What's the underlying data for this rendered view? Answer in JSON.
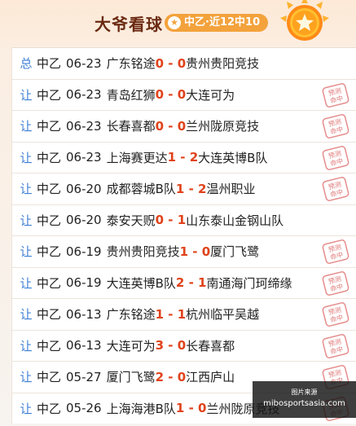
{
  "header": {
    "title": "大爷看球",
    "badge_icon": "star-icon",
    "badge_text": "中乙·近12中10",
    "medal_icon": "gold-star-medal-icon"
  },
  "stamp_text": "预测命中",
  "rows": [
    {
      "tag": "总",
      "league": "中乙",
      "date": "06-23",
      "home": "广东铭途",
      "score": "0 - 0",
      "away": "贵州贵阳竞技",
      "hit": false
    },
    {
      "tag": "让",
      "league": "中乙",
      "date": "06-23",
      "home": "青岛红狮",
      "score": "0 - 0",
      "away": "大连可为",
      "hit": true
    },
    {
      "tag": "让",
      "league": "中乙",
      "date": "06-23",
      "home": "长春喜都",
      "score": "0 - 0",
      "away": "兰州陇原竞技",
      "hit": true
    },
    {
      "tag": "让",
      "league": "中乙",
      "date": "06-23",
      "home": "上海赛更达",
      "score": "1 - 2",
      "away": "大连英博B队",
      "hit": true
    },
    {
      "tag": "让",
      "league": "中乙",
      "date": "06-20",
      "home": "成都蓉城B队",
      "score": "1 - 2",
      "away": "温州职业",
      "hit": true
    },
    {
      "tag": "让",
      "league": "中乙",
      "date": "06-20",
      "home": "泰安天贶",
      "score": "0 - 1",
      "away": "山东泰山金钢山队",
      "hit": false
    },
    {
      "tag": "让",
      "league": "中乙",
      "date": "06-19",
      "home": "贵州贵阳竞技",
      "score": "1 - 0",
      "away": "厦门飞鹭",
      "hit": true
    },
    {
      "tag": "让",
      "league": "中乙",
      "date": "06-19",
      "home": "大连英博B队",
      "score": "2 - 1",
      "away": "南通海门珂缔缘",
      "hit": true
    },
    {
      "tag": "让",
      "league": "中乙",
      "date": "06-13",
      "home": "广东铭途",
      "score": "1 - 1",
      "away": "杭州临平吴越",
      "hit": true
    },
    {
      "tag": "让",
      "league": "中乙",
      "date": "06-13",
      "home": "大连可为",
      "score": "3 - 0",
      "away": "长春喜都",
      "hit": true
    },
    {
      "tag": "让",
      "league": "中乙",
      "date": "05-27",
      "home": "厦门飞鹭",
      "score": "2 - 0",
      "away": "江西庐山",
      "hit": true
    },
    {
      "tag": "让",
      "league": "中乙",
      "date": "05-26",
      "home": "上海海港B队",
      "score": "1 - 0",
      "away": "兰州陇原竞技",
      "hit": true
    }
  ],
  "watermark": {
    "label": "图片来源",
    "url": "mibosportsasia.com"
  }
}
